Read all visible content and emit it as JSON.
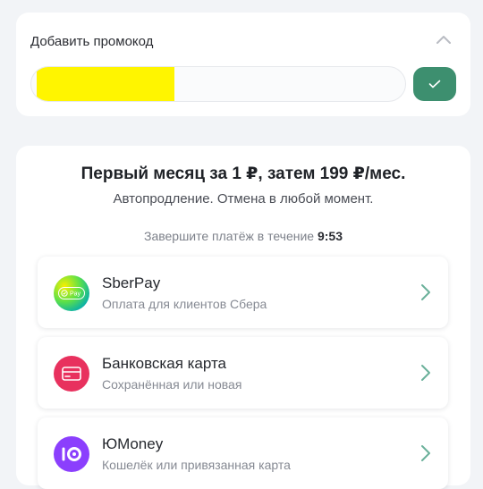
{
  "promo": {
    "title": "Добавить промокод",
    "input_value": "",
    "input_placeholder": ""
  },
  "offer": {
    "title": "Первый месяц за 1 ₽, затем 199 ₽/мес.",
    "subtitle": "Автопродление. Отмена в любой момент.",
    "timer_label": "Завершите платёж в течение",
    "timer_value": "9:53"
  },
  "methods": [
    {
      "name": "SberPay",
      "description": "Оплата для клиентов Сбера",
      "icon": "sberpay-icon",
      "badge_text": "Pay"
    },
    {
      "name": "Банковская карта",
      "description": "Сохранённая или новая",
      "icon": "bank-card-icon"
    },
    {
      "name": "ЮMoney",
      "description": "Кошелёк или привязанная карта",
      "icon": "yumoney-icon"
    }
  ],
  "colors": {
    "accent_green": "#3d8f6f",
    "card_icon_bg": "#e8315e",
    "yumoney_bg": "#8b3ffd",
    "chevron": "#6ab09a",
    "redaction": "#fff500"
  }
}
